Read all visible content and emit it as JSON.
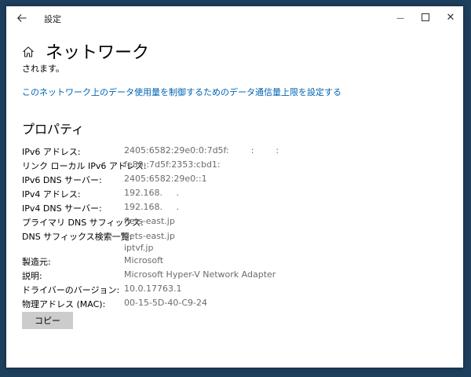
{
  "titlebar": {
    "back_icon": "back-arrow-icon",
    "title": "設定",
    "minimize_glyph": "—",
    "close_glyph": "✕"
  },
  "page": {
    "home_icon": "home-icon",
    "title": "ネットワーク",
    "cut_text": "されます。",
    "data_limit_link": "このネットワーク上のデータ使用量を制御するためのデータ通信量上限を設定する"
  },
  "properties": {
    "title": "プロパティ",
    "rows": [
      {
        "key": "IPv6 アドレス:",
        "value": "2405:6582:29e0:0:7d5f:        :        :"
      },
      {
        "key": "リンク ローカル IPv6 アドレス:",
        "value": "fe80::7d5f:2353:cbd1:"
      },
      {
        "key": "IPv6 DNS サーバー:",
        "value": "2405:6582:29e0::1"
      },
      {
        "key": "IPv4 アドレス:",
        "value": "192.168.     ."
      },
      {
        "key": "IPv4 DNS サーバー:",
        "value": "192.168.     ."
      },
      {
        "key": "プライマリ DNS サフィックス:",
        "value": "flets-east.jp"
      },
      {
        "key": "DNS サフィックス検索一覧:",
        "value": "flets-east.jp\niptvf.jp"
      },
      {
        "key": "製造元:",
        "value": "Microsoft"
      },
      {
        "key": "説明:",
        "value": "Microsoft Hyper-V Network Adapter"
      },
      {
        "key": "ドライバーのバージョン:",
        "value": "10.0.17763.1"
      },
      {
        "key": "物理アドレス (MAC):",
        "value": "00-15-5D-40-C9-24"
      }
    ],
    "copy_label": "コピー"
  },
  "colors": {
    "link": "#0063b1",
    "value_text": "#6b6b6b",
    "button_bg": "#cccccc",
    "desktop": "#1f3f5e"
  }
}
